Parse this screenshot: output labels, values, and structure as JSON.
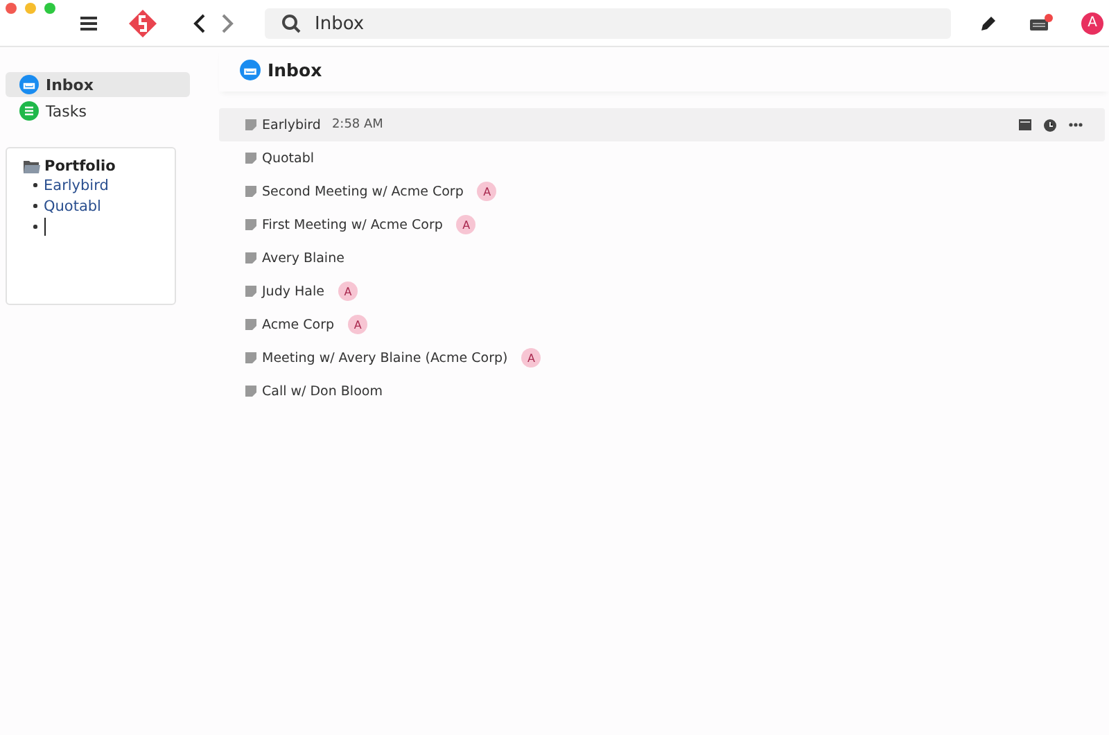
{
  "toolbar": {
    "search": {
      "value": "Inbox"
    },
    "avatar": "A",
    "notification": true
  },
  "sidebar": {
    "items": [
      {
        "label": "Inbox",
        "kind": "inbox",
        "selected": true
      },
      {
        "label": "Tasks",
        "kind": "tasks",
        "selected": false
      }
    ]
  },
  "portfolio": {
    "title": "Portfolio",
    "items": [
      "Earlybird",
      "Quotabl"
    ],
    "editing": true
  },
  "main": {
    "title": "Inbox",
    "rows": [
      {
        "title": "Earlybird",
        "time": "2:58 AM",
        "selected": true
      },
      {
        "title": "Quotabl",
        "selected": false
      },
      {
        "title": "Second Meeting w/ Acme Corp",
        "badge": "A",
        "selected": false
      },
      {
        "title": "First Meeting w/ Acme Corp",
        "badge": "A",
        "selected": false
      },
      {
        "title": "Avery Blaine",
        "selected": false
      },
      {
        "title": "Judy Hale",
        "badge": "A",
        "selected": false
      },
      {
        "title": "Acme Corp",
        "badge": "A",
        "selected": false
      },
      {
        "title": "Meeting w/ Avery Blaine (Acme Corp)",
        "badge": "A",
        "selected": false
      },
      {
        "title": "Call w/ Don Bloom",
        "selected": false
      }
    ]
  }
}
